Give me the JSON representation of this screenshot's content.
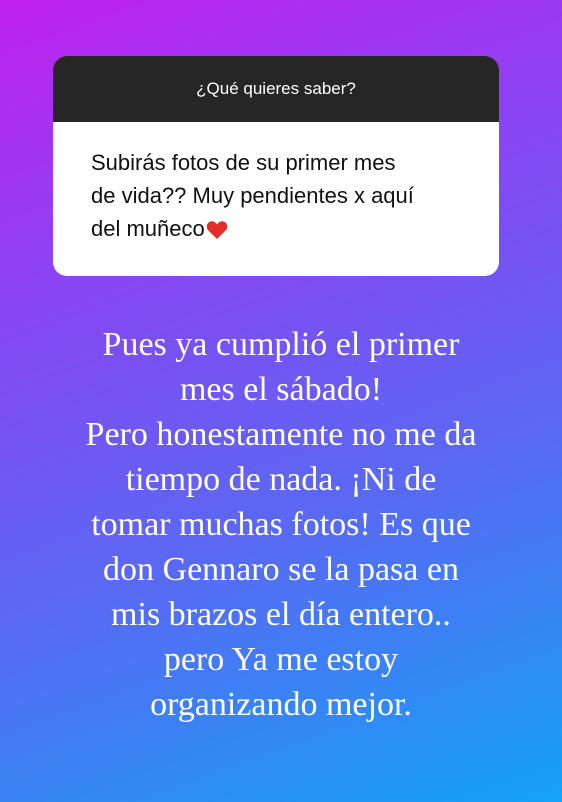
{
  "question_card": {
    "header": "¿Qué quieres saber?",
    "question": "Subirás fotos de su primer mes\nde vida?? Muy pendientes x aquí\ndel muñeco",
    "icon": "heart-icon",
    "heart_color": "#e52d27",
    "header_bg": "#262626",
    "card_bg": "#ffffff"
  },
  "reply": {
    "text": "Pues ya cumplió el primer\nmes el sábado!\nPero honestamente no me da\ntiempo de nada. ¡Ni de\ntomar muchas fotos! Es que\ndon Gennaro se la pasa en\nmis brazos el día entero..\npero Ya me estoy\norganizando mejor."
  },
  "background": {
    "gradient": [
      "#c020f0",
      "#8a44f2",
      "#5a68f3",
      "#13a2f7"
    ]
  }
}
